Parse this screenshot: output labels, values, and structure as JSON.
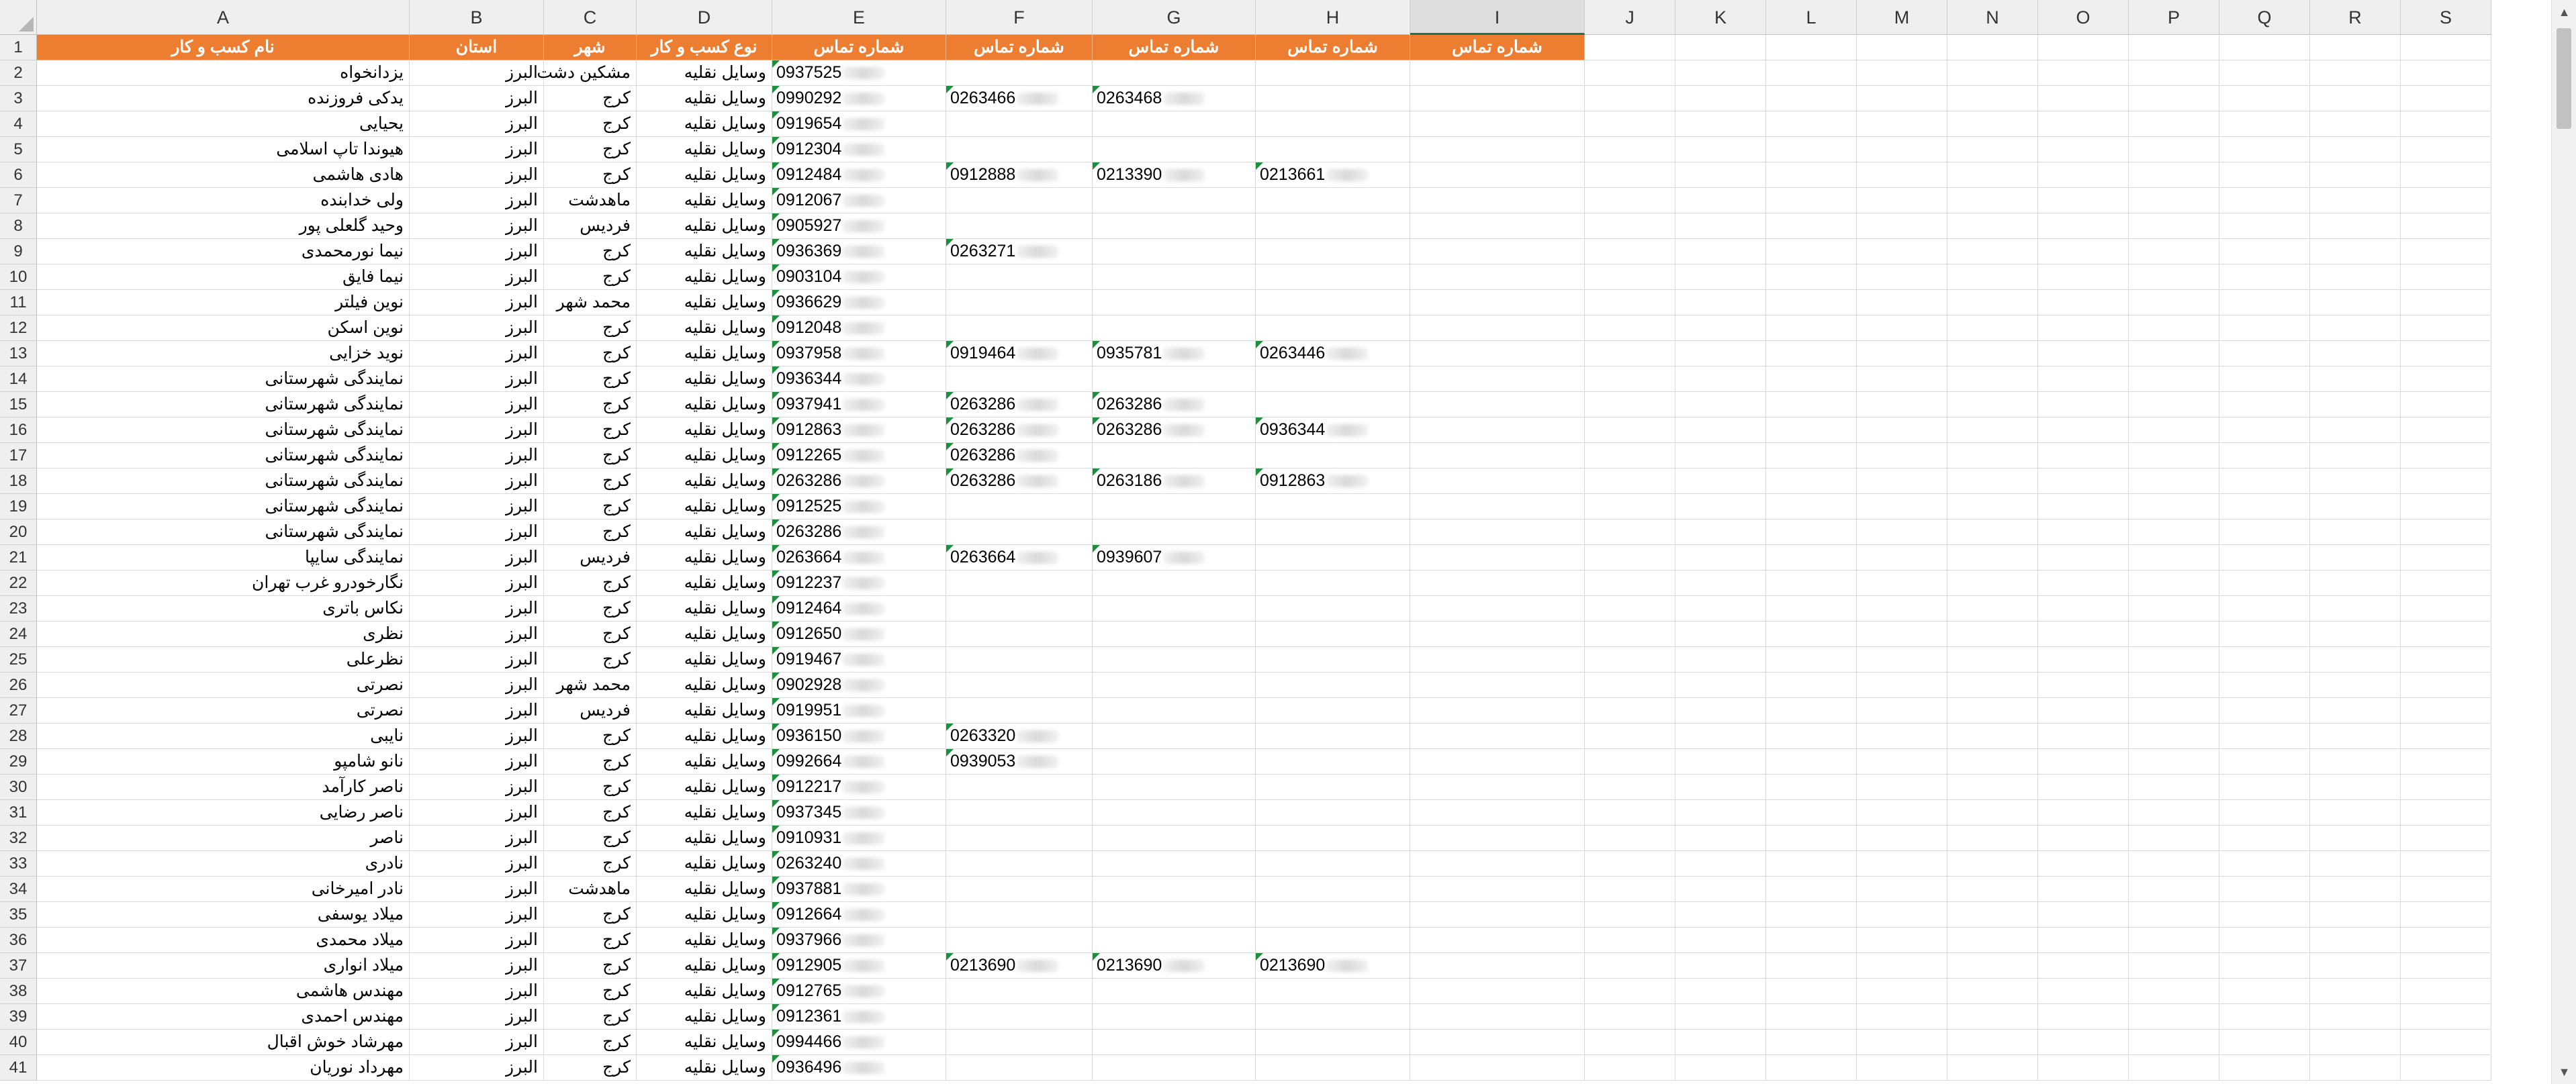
{
  "columns": [
    "A",
    "B",
    "C",
    "D",
    "E",
    "F",
    "G",
    "H",
    "I",
    "J",
    "K",
    "L",
    "M",
    "N",
    "O",
    "P",
    "Q",
    "R",
    "S"
  ],
  "selected_column": "I",
  "header_row": {
    "business_name": "نام کسب و کار",
    "province": "استان",
    "city": "شهر",
    "business_type": "نوع کسب و کار",
    "phone1": "شماره تماس",
    "phone2": "شماره تماس",
    "phone3": "شماره تماس",
    "phone4": "شماره تماس",
    "phone5": "شماره تماس"
  },
  "rows": [
    {
      "num": "2",
      "name": "یزدانخواه",
      "province": "البرز",
      "city": "مشکین دشت",
      "type": "وسایل نقلیه",
      "p1": "0937525",
      "p2": "",
      "p3": "",
      "p4": ""
    },
    {
      "num": "3",
      "name": "یدکی فروزنده",
      "province": "البرز",
      "city": "کرج",
      "type": "وسایل نقلیه",
      "p1": "0990292",
      "p2": "0263466",
      "p3": "0263468",
      "p4": ""
    },
    {
      "num": "4",
      "name": "یحیایی",
      "province": "البرز",
      "city": "کرج",
      "type": "وسایل نقلیه",
      "p1": "0919654",
      "p2": "",
      "p3": "",
      "p4": ""
    },
    {
      "num": "5",
      "name": "هیوندا تاپ اسلامی",
      "province": "البرز",
      "city": "کرج",
      "type": "وسایل نقلیه",
      "p1": "0912304",
      "p2": "",
      "p3": "",
      "p4": ""
    },
    {
      "num": "6",
      "name": "هادی هاشمی",
      "province": "البرز",
      "city": "کرج",
      "type": "وسایل نقلیه",
      "p1": "0912484",
      "p2": "0912888",
      "p3": "0213390",
      "p4": "0213661"
    },
    {
      "num": "7",
      "name": "ولی خدابنده",
      "province": "البرز",
      "city": "ماهدشت",
      "type": "وسایل نقلیه",
      "p1": "0912067",
      "p2": "",
      "p3": "",
      "p4": ""
    },
    {
      "num": "8",
      "name": "وحید گلعلی پور",
      "province": "البرز",
      "city": "فردیس",
      "type": "وسایل نقلیه",
      "p1": "0905927",
      "p2": "",
      "p3": "",
      "p4": ""
    },
    {
      "num": "9",
      "name": "نیما نورمحمدی",
      "province": "البرز",
      "city": "کرج",
      "type": "وسایل نقلیه",
      "p1": "0936369",
      "p2": "0263271",
      "p3": "",
      "p4": ""
    },
    {
      "num": "10",
      "name": "نیما فایق",
      "province": "البرز",
      "city": "کرج",
      "type": "وسایل نقلیه",
      "p1": "0903104",
      "p2": "",
      "p3": "",
      "p4": ""
    },
    {
      "num": "11",
      "name": "نوین فیلتر",
      "province": "البرز",
      "city": "محمد شهر",
      "type": "وسایل نقلیه",
      "p1": "0936629",
      "p2": "",
      "p3": "",
      "p4": ""
    },
    {
      "num": "12",
      "name": "نوین اسکن",
      "province": "البرز",
      "city": "کرج",
      "type": "وسایل نقلیه",
      "p1": "0912048",
      "p2": "",
      "p3": "",
      "p4": ""
    },
    {
      "num": "13",
      "name": "نوید خزایی",
      "province": "البرز",
      "city": "کرج",
      "type": "وسایل نقلیه",
      "p1": "0937958",
      "p2": "0919464",
      "p3": "0935781",
      "p4": "0263446"
    },
    {
      "num": "14",
      "name": "نمایندگی شهرستانی",
      "province": "البرز",
      "city": "کرج",
      "type": "وسایل نقلیه",
      "p1": "0936344",
      "p2": "",
      "p3": "",
      "p4": ""
    },
    {
      "num": "15",
      "name": "نمایندگی شهرستانی",
      "province": "البرز",
      "city": "کرج",
      "type": "وسایل نقلیه",
      "p1": "0937941",
      "p2": "0263286",
      "p3": "0263286",
      "p4": ""
    },
    {
      "num": "16",
      "name": "نمایندگی شهرستانی",
      "province": "البرز",
      "city": "کرج",
      "type": "وسایل نقلیه",
      "p1": "0912863",
      "p2": "0263286",
      "p3": "0263286",
      "p4": "0936344"
    },
    {
      "num": "17",
      "name": "نمایندگی شهرستانی",
      "province": "البرز",
      "city": "کرج",
      "type": "وسایل نقلیه",
      "p1": "0912265",
      "p2": "0263286",
      "p3": "",
      "p4": ""
    },
    {
      "num": "18",
      "name": "نمایندگی شهرستانی",
      "province": "البرز",
      "city": "کرج",
      "type": "وسایل نقلیه",
      "p1": "0263286",
      "p2": "0263286",
      "p3": "0263186",
      "p4": "0912863"
    },
    {
      "num": "19",
      "name": "نمایندگی شهرستانی",
      "province": "البرز",
      "city": "کرج",
      "type": "وسایل نقلیه",
      "p1": "0912525",
      "p2": "",
      "p3": "",
      "p4": ""
    },
    {
      "num": "20",
      "name": "نمایندگی شهرستانی",
      "province": "البرز",
      "city": "کرج",
      "type": "وسایل نقلیه",
      "p1": "0263286",
      "p2": "",
      "p3": "",
      "p4": ""
    },
    {
      "num": "21",
      "name": "نمایندگی سایپا",
      "province": "البرز",
      "city": "فردیس",
      "type": "وسایل نقلیه",
      "p1": "0263664",
      "p2": "0263664",
      "p3": "0939607",
      "p4": ""
    },
    {
      "num": "22",
      "name": "نگارخودرو غرب تهران",
      "province": "البرز",
      "city": "کرج",
      "type": "وسایل نقلیه",
      "p1": "0912237",
      "p2": "",
      "p3": "",
      "p4": ""
    },
    {
      "num": "23",
      "name": "نکاس باتری",
      "province": "البرز",
      "city": "کرج",
      "type": "وسایل نقلیه",
      "p1": "0912464",
      "p2": "",
      "p3": "",
      "p4": ""
    },
    {
      "num": "24",
      "name": "نظری",
      "province": "البرز",
      "city": "کرج",
      "type": "وسایل نقلیه",
      "p1": "0912650",
      "p2": "",
      "p3": "",
      "p4": ""
    },
    {
      "num": "25",
      "name": "نظرعلی",
      "province": "البرز",
      "city": "کرج",
      "type": "وسایل نقلیه",
      "p1": "0919467",
      "p2": "",
      "p3": "",
      "p4": ""
    },
    {
      "num": "26",
      "name": "نصرتی",
      "province": "البرز",
      "city": "محمد شهر",
      "type": "وسایل نقلیه",
      "p1": "0902928",
      "p2": "",
      "p3": "",
      "p4": ""
    },
    {
      "num": "27",
      "name": "نصرتی",
      "province": "البرز",
      "city": "فردیس",
      "type": "وسایل نقلیه",
      "p1": "0919951",
      "p2": "",
      "p3": "",
      "p4": ""
    },
    {
      "num": "28",
      "name": "نایبی",
      "province": "البرز",
      "city": "کرج",
      "type": "وسایل نقلیه",
      "p1": "0936150",
      "p2": "0263320",
      "p3": "",
      "p4": ""
    },
    {
      "num": "29",
      "name": "نانو شامپو",
      "province": "البرز",
      "city": "کرج",
      "type": "وسایل نقلیه",
      "p1": "0992664",
      "p2": "0939053",
      "p3": "",
      "p4": ""
    },
    {
      "num": "30",
      "name": "ناصر کارآمد",
      "province": "البرز",
      "city": "کرج",
      "type": "وسایل نقلیه",
      "p1": "0912217",
      "p2": "",
      "p3": "",
      "p4": ""
    },
    {
      "num": "31",
      "name": "ناصر رضایی",
      "province": "البرز",
      "city": "کرج",
      "type": "وسایل نقلیه",
      "p1": "0937345",
      "p2": "",
      "p3": "",
      "p4": ""
    },
    {
      "num": "32",
      "name": "ناصر",
      "province": "البرز",
      "city": "کرج",
      "type": "وسایل نقلیه",
      "p1": "0910931",
      "p2": "",
      "p3": "",
      "p4": ""
    },
    {
      "num": "33",
      "name": "نادری",
      "province": "البرز",
      "city": "کرج",
      "type": "وسایل نقلیه",
      "p1": "0263240",
      "p2": "",
      "p3": "",
      "p4": ""
    },
    {
      "num": "34",
      "name": "نادر امیرخانی",
      "province": "البرز",
      "city": "ماهدشت",
      "type": "وسایل نقلیه",
      "p1": "0937881",
      "p2": "",
      "p3": "",
      "p4": ""
    },
    {
      "num": "35",
      "name": "میلاد یوسفی",
      "province": "البرز",
      "city": "کرج",
      "type": "وسایل نقلیه",
      "p1": "0912664",
      "p2": "",
      "p3": "",
      "p4": ""
    },
    {
      "num": "36",
      "name": "میلاد محمدی",
      "province": "البرز",
      "city": "کرج",
      "type": "وسایل نقلیه",
      "p1": "0937966",
      "p2": "",
      "p3": "",
      "p4": ""
    },
    {
      "num": "37",
      "name": "میلاد انواری",
      "province": "البرز",
      "city": "کرج",
      "type": "وسایل نقلیه",
      "p1": "0912905",
      "p2": "0213690",
      "p3": "0213690",
      "p4": "0213690"
    },
    {
      "num": "38",
      "name": "مهندس هاشمی",
      "province": "البرز",
      "city": "کرج",
      "type": "وسایل نقلیه",
      "p1": "0912765",
      "p2": "",
      "p3": "",
      "p4": ""
    },
    {
      "num": "39",
      "name": "مهندس احمدی",
      "province": "البرز",
      "city": "کرج",
      "type": "وسایل نقلیه",
      "p1": "0912361",
      "p2": "",
      "p3": "",
      "p4": ""
    },
    {
      "num": "40",
      "name": "مهرشاد خوش اقبال",
      "province": "البرز",
      "city": "کرج",
      "type": "وسایل نقلیه",
      "p1": "0994466",
      "p2": "",
      "p3": "",
      "p4": ""
    },
    {
      "num": "41",
      "name": "مهرداد نوریان",
      "province": "البرز",
      "city": "کرج",
      "type": "وسایل نقلیه",
      "p1": "0936496",
      "p2": "",
      "p3": "",
      "p4": ""
    }
  ],
  "scrollbar": {
    "up_arrow": "▲",
    "down_arrow": "▼"
  },
  "colors": {
    "header_fill": "#ed7d31",
    "header_text": "#ffffff",
    "gridline": "#d9d9d9",
    "select_accent": "#217346",
    "note_flag": "#1e8f3e"
  }
}
